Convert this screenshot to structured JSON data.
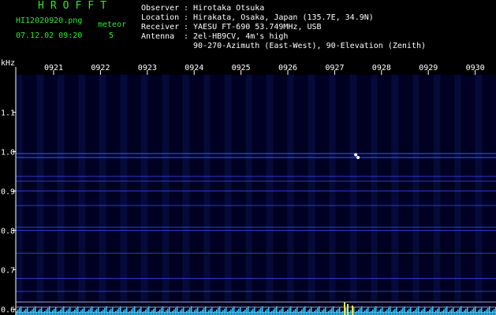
{
  "header": {
    "app_name": "HROFFT",
    "filename": "HI12020920.png",
    "datetime": "07.12.02 09:20",
    "meteor_label": "meteor",
    "meteor_count": "5"
  },
  "info": {
    "rows": [
      {
        "label": "Observer",
        "sep": ":",
        "value": "Hirotaka Otsuka"
      },
      {
        "label": "Location",
        "sep": ":",
        "value": "Hirakata, Osaka, Japan (135.7E, 34.9N)"
      },
      {
        "label": "Receiver",
        "sep": ":",
        "value": "YAESU FT-690 53.749MHz, USB"
      },
      {
        "label": "Antenna",
        "sep": ":",
        "value": "2el-HB9CV, 4m's high"
      },
      {
        "label": "",
        "sep": "",
        "value": "90-270-Azimuth (East-West), 90-Elevation (Zenith)"
      }
    ]
  },
  "chart_data": {
    "type": "heatmap",
    "ylabel": "kHz",
    "x_ticks": [
      "0921",
      "0922",
      "0923",
      "0924",
      "0925",
      "0926",
      "0927",
      "0928",
      "0929",
      "0930"
    ],
    "y_ticks": [
      "1.1",
      "1.0",
      "0.9",
      "0.8",
      "0.7",
      "0.6"
    ],
    "y_tick_values": [
      1.1,
      1.0,
      0.9,
      0.8,
      0.7,
      0.6
    ],
    "ylim": [
      0.585,
      1.195
    ],
    "xlim": [
      0,
      10
    ],
    "background_color": "#000022",
    "trace_color": "#3a4cff",
    "meteor_color": "#ffffff",
    "bar_color": "#30c8ff",
    "meteor_bar_color": "#e6e64a",
    "horizontal_traces": [
      0.995,
      0.985,
      0.937,
      0.925,
      0.9,
      0.863,
      0.808,
      0.8,
      0.742,
      0.678,
      0.645
    ],
    "reference_lines": [
      0.618,
      0.605,
      0.592
    ],
    "meteor_events": [
      {
        "x": 6.45,
        "y": 0.992
      },
      {
        "x": 6.5,
        "y": 0.985
      }
    ]
  }
}
